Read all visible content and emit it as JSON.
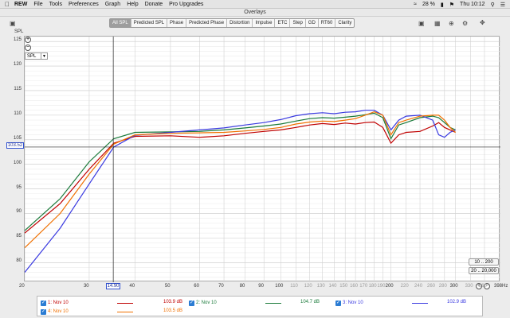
{
  "menubar": {
    "app": "REW",
    "items": [
      "File",
      "Tools",
      "Preferences",
      "Graph",
      "Help",
      "Donate",
      "Pro Upgrades"
    ],
    "battery": "28 %",
    "clock": "Thu 10:12"
  },
  "window": {
    "title": "Overlays"
  },
  "tabs": [
    "All SPL",
    "Predicted SPL",
    "Phase",
    "Predicted Phase",
    "Distortion",
    "Impulse",
    "ETC",
    "Step",
    "GD",
    "RT60",
    "Clarity"
  ],
  "active_tab": "All SPL",
  "yaxis": {
    "unit": "SPL",
    "select_value": "SPL",
    "cursor_value": "103.52"
  },
  "xaxis": {
    "cursor_value": "14.90",
    "unit": "Hz"
  },
  "buttons": {
    "range_y": "10 .. 200",
    "range_x": "20 .. 20,000"
  },
  "legend": [
    {
      "label": "1: Nov 10",
      "value": "103.9 dB",
      "color": "#c00000"
    },
    {
      "label": "2: Nov 10",
      "value": "104.7 dB",
      "color": "#1a7a3a"
    },
    {
      "label": "3: Nov 10",
      "value": "102.9 dB",
      "color": "#3a3ae0"
    },
    {
      "label": "4: Nov 10",
      "value": "103.5 dB",
      "color": "#f07000"
    }
  ],
  "chart_data": {
    "type": "line",
    "xscale": "log",
    "xlim": [
      20,
      398
    ],
    "ylim": [
      76,
      126
    ],
    "yticks": [
      80,
      85,
      90,
      95,
      100,
      105,
      110,
      115,
      120,
      125
    ],
    "xticks": [
      {
        "v": 20,
        "l": "20",
        "dim": false
      },
      {
        "v": 30,
        "l": "30",
        "dim": false
      },
      {
        "v": 40,
        "l": "40",
        "dim": false
      },
      {
        "v": 50,
        "l": "50",
        "dim": false
      },
      {
        "v": 60,
        "l": "60",
        "dim": false
      },
      {
        "v": 70,
        "l": "70",
        "dim": false
      },
      {
        "v": 80,
        "l": "80",
        "dim": false
      },
      {
        "v": 90,
        "l": "90",
        "dim": false
      },
      {
        "v": 100,
        "l": "100",
        "dim": false
      },
      {
        "v": 110,
        "l": "110",
        "dim": true
      },
      {
        "v": 120,
        "l": "120",
        "dim": true
      },
      {
        "v": 130,
        "l": "130",
        "dim": true
      },
      {
        "v": 140,
        "l": "140",
        "dim": true
      },
      {
        "v": 150,
        "l": "150",
        "dim": true
      },
      {
        "v": 160,
        "l": "160",
        "dim": true
      },
      {
        "v": 170,
        "l": "170",
        "dim": true
      },
      {
        "v": 180,
        "l": "180",
        "dim": true
      },
      {
        "v": 190,
        "l": "190",
        "dim": true
      },
      {
        "v": 200,
        "l": "200",
        "dim": false
      },
      {
        "v": 220,
        "l": "220",
        "dim": true
      },
      {
        "v": 240,
        "l": "240",
        "dim": true
      },
      {
        "v": 260,
        "l": "260",
        "dim": true
      },
      {
        "v": 280,
        "l": "280",
        "dim": true
      },
      {
        "v": 300,
        "l": "300",
        "dim": false
      },
      {
        "v": 330,
        "l": "330",
        "dim": true
      },
      {
        "v": 360,
        "l": "360",
        "dim": true
      },
      {
        "v": 398,
        "l": "398Hz",
        "dim": false
      }
    ],
    "cursor": {
      "x": 34.9,
      "y": 103.52
    },
    "series": [
      {
        "name": "1: Nov 10",
        "color": "#c00000",
        "points": [
          [
            20,
            86
          ],
          [
            25,
            92
          ],
          [
            30,
            99
          ],
          [
            35,
            104.3
          ],
          [
            40,
            105.7
          ],
          [
            50,
            105.8
          ],
          [
            60,
            105.5
          ],
          [
            70,
            105.8
          ],
          [
            80,
            106.3
          ],
          [
            90,
            106.7
          ],
          [
            100,
            107
          ],
          [
            110,
            107.5
          ],
          [
            120,
            108
          ],
          [
            130,
            108.3
          ],
          [
            140,
            108.1
          ],
          [
            150,
            108.4
          ],
          [
            160,
            108.2
          ],
          [
            170,
            108.5
          ],
          [
            180,
            108.6
          ],
          [
            190,
            107.5
          ],
          [
            200,
            104.3
          ],
          [
            210,
            106
          ],
          [
            220,
            106.5
          ],
          [
            240,
            106.7
          ],
          [
            260,
            107.8
          ],
          [
            270,
            108.5
          ],
          [
            280,
            107.5
          ],
          [
            290,
            107
          ],
          [
            300,
            106.5
          ]
        ]
      },
      {
        "name": "2: Nov 10",
        "color": "#1a7a3a",
        "points": [
          [
            20,
            86.5
          ],
          [
            25,
            93
          ],
          [
            30,
            100.5
          ],
          [
            35,
            105.2
          ],
          [
            40,
            106.5
          ],
          [
            50,
            106.6
          ],
          [
            60,
            106.7
          ],
          [
            70,
            107
          ],
          [
            80,
            107.4
          ],
          [
            90,
            107.8
          ],
          [
            100,
            108.2
          ],
          [
            110,
            108.8
          ],
          [
            120,
            109.3
          ],
          [
            130,
            109.5
          ],
          [
            140,
            109.4
          ],
          [
            150,
            109.6
          ],
          [
            160,
            109.8
          ],
          [
            170,
            110.1
          ],
          [
            180,
            110.4
          ],
          [
            190,
            109.5
          ],
          [
            200,
            105.2
          ],
          [
            210,
            108
          ],
          [
            220,
            108.5
          ],
          [
            240,
            109.5
          ],
          [
            260,
            109.8
          ],
          [
            270,
            109.5
          ],
          [
            280,
            108.5
          ],
          [
            290,
            107.5
          ],
          [
            300,
            107
          ]
        ]
      },
      {
        "name": "3: Nov 10",
        "color": "#3a3ae0",
        "points": [
          [
            20,
            78
          ],
          [
            25,
            87
          ],
          [
            30,
            96
          ],
          [
            35,
            103.5
          ],
          [
            40,
            105.9
          ],
          [
            50,
            106.5
          ],
          [
            60,
            107
          ],
          [
            70,
            107.4
          ],
          [
            80,
            108
          ],
          [
            90,
            108.5
          ],
          [
            100,
            109.1
          ],
          [
            110,
            109.9
          ],
          [
            120,
            110.3
          ],
          [
            130,
            110.5
          ],
          [
            140,
            110.3
          ],
          [
            150,
            110.6
          ],
          [
            160,
            110.7
          ],
          [
            170,
            111
          ],
          [
            180,
            111
          ],
          [
            190,
            110
          ],
          [
            200,
            107
          ],
          [
            210,
            109
          ],
          [
            220,
            109.8
          ],
          [
            240,
            110
          ],
          [
            260,
            109
          ],
          [
            270,
            106
          ],
          [
            280,
            105.5
          ],
          [
            290,
            106.5
          ],
          [
            300,
            107
          ]
        ]
      },
      {
        "name": "4: Nov 10",
        "color": "#f07000",
        "points": [
          [
            20,
            83
          ],
          [
            25,
            90
          ],
          [
            30,
            98
          ],
          [
            35,
            104.1
          ],
          [
            40,
            106
          ],
          [
            50,
            106.3
          ],
          [
            60,
            106.4
          ],
          [
            70,
            106.5
          ],
          [
            80,
            106.8
          ],
          [
            90,
            107.1
          ],
          [
            100,
            107.5
          ],
          [
            110,
            108.2
          ],
          [
            120,
            108.6
          ],
          [
            130,
            108.8
          ],
          [
            140,
            108.7
          ],
          [
            150,
            109
          ],
          [
            160,
            109.3
          ],
          [
            170,
            110
          ],
          [
            180,
            110.7
          ],
          [
            190,
            110
          ],
          [
            200,
            106
          ],
          [
            210,
            108.5
          ],
          [
            220,
            109
          ],
          [
            240,
            109.8
          ],
          [
            260,
            110
          ],
          [
            270,
            110
          ],
          [
            280,
            109
          ],
          [
            290,
            107.5
          ],
          [
            300,
            106.5
          ]
        ]
      }
    ]
  }
}
